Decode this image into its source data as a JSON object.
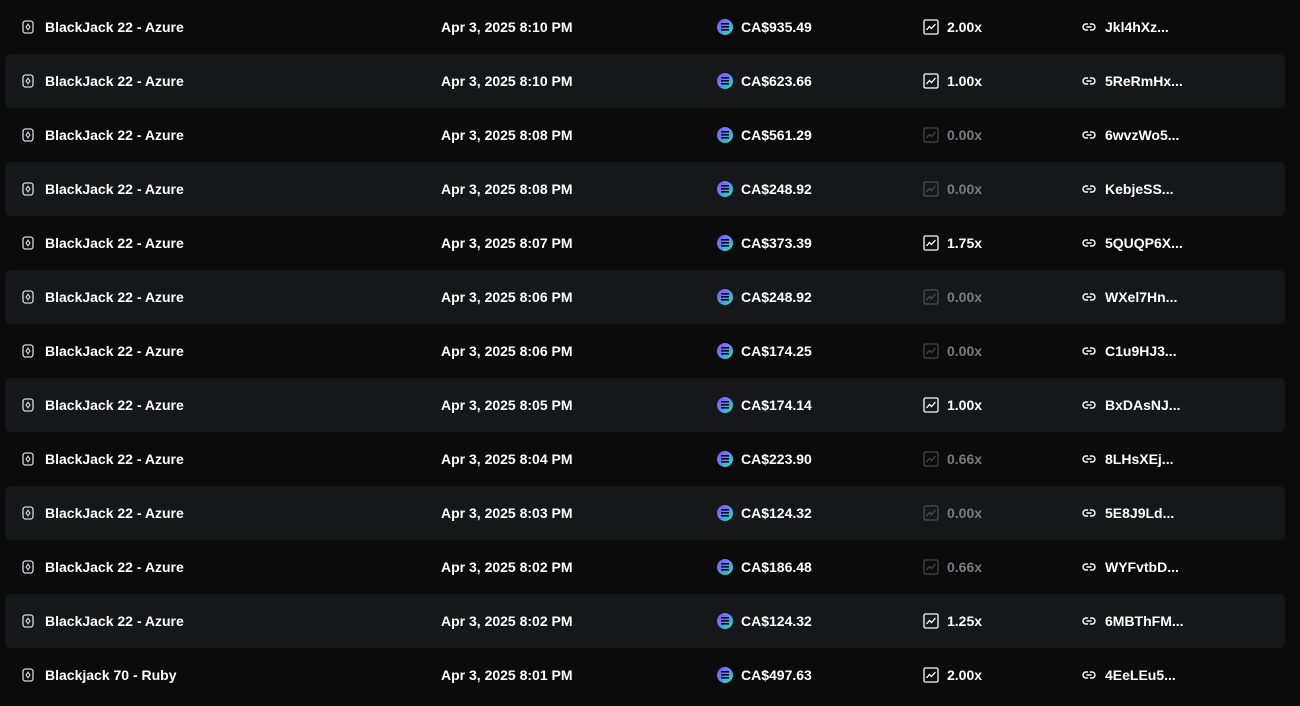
{
  "bets": [
    {
      "game": "BlackJack 22 - Azure",
      "date": "Apr 3, 2025 8:10 PM",
      "amount": "CA$935.49",
      "multiplier": "2.00x",
      "win": true,
      "hash": "Jkl4hXz..."
    },
    {
      "game": "BlackJack 22 - Azure",
      "date": "Apr 3, 2025 8:10 PM",
      "amount": "CA$623.66",
      "multiplier": "1.00x",
      "win": true,
      "hash": "5ReRmHx..."
    },
    {
      "game": "BlackJack 22 - Azure",
      "date": "Apr 3, 2025 8:08 PM",
      "amount": "CA$561.29",
      "multiplier": "0.00x",
      "win": false,
      "hash": "6wvzWo5..."
    },
    {
      "game": "BlackJack 22 - Azure",
      "date": "Apr 3, 2025 8:08 PM",
      "amount": "CA$248.92",
      "multiplier": "0.00x",
      "win": false,
      "hash": "KebjeSS..."
    },
    {
      "game": "BlackJack 22 - Azure",
      "date": "Apr 3, 2025 8:07 PM",
      "amount": "CA$373.39",
      "multiplier": "1.75x",
      "win": true,
      "hash": "5QUQP6X..."
    },
    {
      "game": "BlackJack 22 - Azure",
      "date": "Apr 3, 2025 8:06 PM",
      "amount": "CA$248.92",
      "multiplier": "0.00x",
      "win": false,
      "hash": "WXel7Hn..."
    },
    {
      "game": "BlackJack 22 - Azure",
      "date": "Apr 3, 2025 8:06 PM",
      "amount": "CA$174.25",
      "multiplier": "0.00x",
      "win": false,
      "hash": "C1u9HJ3..."
    },
    {
      "game": "BlackJack 22 - Azure",
      "date": "Apr 3, 2025 8:05 PM",
      "amount": "CA$174.14",
      "multiplier": "1.00x",
      "win": true,
      "hash": "BxDAsNJ..."
    },
    {
      "game": "BlackJack 22 - Azure",
      "date": "Apr 3, 2025 8:04 PM",
      "amount": "CA$223.90",
      "multiplier": "0.66x",
      "win": false,
      "hash": "8LHsXEj..."
    },
    {
      "game": "BlackJack 22 - Azure",
      "date": "Apr 3, 2025 8:03 PM",
      "amount": "CA$124.32",
      "multiplier": "0.00x",
      "win": false,
      "hash": "5E8J9Ld..."
    },
    {
      "game": "BlackJack 22 - Azure",
      "date": "Apr 3, 2025 8:02 PM",
      "amount": "CA$186.48",
      "multiplier": "0.66x",
      "win": false,
      "hash": "WYFvtbD..."
    },
    {
      "game": "BlackJack 22 - Azure",
      "date": "Apr 3, 2025 8:02 PM",
      "amount": "CA$124.32",
      "multiplier": "1.25x",
      "win": true,
      "hash": "6MBThFM..."
    },
    {
      "game": "Blackjack 70 - Ruby",
      "date": "Apr 3, 2025 8:01 PM",
      "amount": "CA$497.63",
      "multiplier": "2.00x",
      "win": true,
      "hash": "4EeLEu5..."
    }
  ],
  "icons": {
    "game": "game-card-icon",
    "currency": "solana-coin-icon",
    "multiplier": "chart-trend-icon",
    "hash": "link-icon"
  },
  "colors": {
    "background": "#0b0b0c",
    "row_alt": "#16171b",
    "text": "#ffffff",
    "muted": "#7a7b80"
  }
}
